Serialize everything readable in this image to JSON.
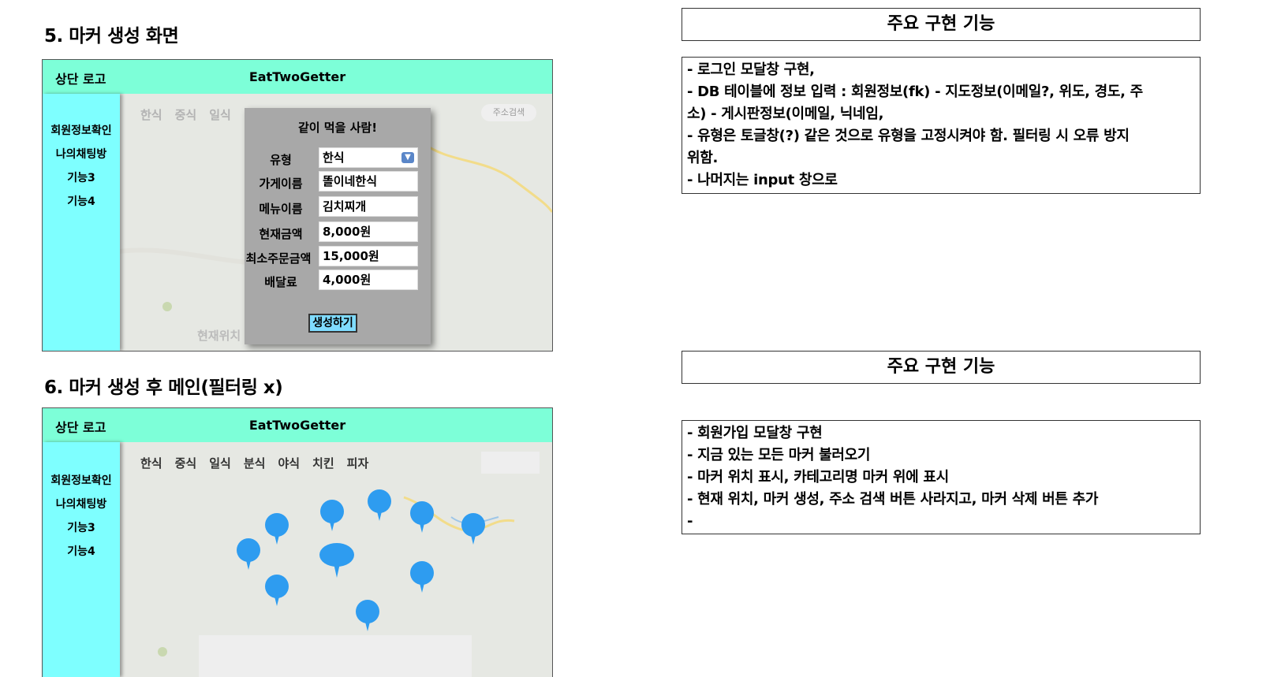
{
  "section5": {
    "heading": "5. 마커 생성 화면",
    "mock": {
      "logo": "상단 로고",
      "title": "EatTwoGetter",
      "sidebar": [
        "회원정보확인",
        "나의채팅방",
        "기능3",
        "기능4"
      ],
      "categories": [
        "한식",
        "중식",
        "일식"
      ],
      "address_search": "주소검색",
      "current_location": "현재위치",
      "modal": {
        "title": "같이 먹을 사람!",
        "fields": [
          {
            "label": "유형",
            "value": "한식"
          },
          {
            "label": "가게이름",
            "value": "똘이네한식"
          },
          {
            "label": "메뉴이름",
            "value": "김치찌개"
          },
          {
            "label": "현재금액",
            "value": "8,000원"
          },
          {
            "label": "최소주문금액",
            "value": "15,000원"
          },
          {
            "label": "배달료",
            "value": "4,000원"
          }
        ],
        "submit": "생성하기"
      }
    }
  },
  "section6": {
    "heading": "6. 마커 생성 후 메인(필터링 x)",
    "mock": {
      "logo": "상단 로고",
      "title": "EatTwoGetter",
      "sidebar": [
        "회원정보확인",
        "나의채팅방",
        "기능3",
        "기능4"
      ],
      "categories": [
        "한식",
        "중식",
        "일식",
        "분식",
        "야식",
        "치킨",
        "피자"
      ]
    }
  },
  "box1": {
    "title": "주요 구현 기능",
    "lines": [
      "- 로그인 모달창 구현,",
      "- DB 테이블에 정보 입력 : 회원정보(fk) - 지도정보(이메일?, 위도, 경도, 주",
      "소) - 게시판정보(이메일, 닉네임,",
      "- 유형은 토글창(?) 같은 것으로 유형을 고정시켜야 함. 필터링 시 오류 방지",
      "위함.",
      "- 나머지는 input 창으로"
    ]
  },
  "box2": {
    "title": "주요 구현 기능",
    "lines": [
      "- 회원가입 모달창 구현",
      "- 지금 있는 모든 마커 불러오기",
      "- 마커 위치 표시, 카테고리명 마커 위에 표시",
      "- 현재 위치, 마커 생성, 주소 검색 버튼 사라지고, 마커 삭제 버튼 추가",
      "-"
    ]
  }
}
